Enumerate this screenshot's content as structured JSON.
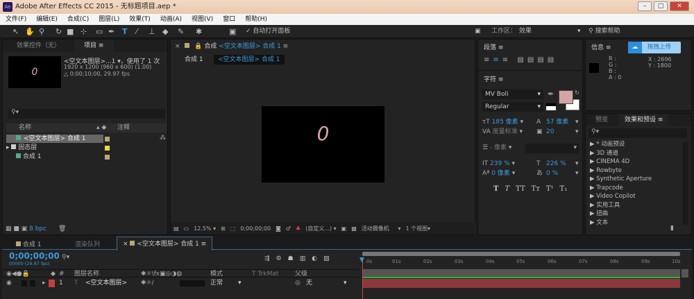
{
  "title": "Adobe After Effects CC 2015 - 无标题项目.aep *",
  "app_logo": "Ae",
  "menu": [
    "文件(F)",
    "编辑(E)",
    "合成(C)",
    "图层(L)",
    "效果(T)",
    "动画(A)",
    "视图(V)",
    "窗口",
    "帮助(H)"
  ],
  "toolbar": {
    "auto_open": "自动打开面板",
    "workspace_label": "工作区：",
    "workspace": "效果",
    "search_help": "搜索帮助"
  },
  "project": {
    "tab_effects": "效果控件（无）",
    "tab_project": "项目",
    "item_name": "<空文本图层>...1 ▾，使用了 1 次",
    "item_size": "1920 x 1200  (960 x 600) (1.00)",
    "item_duration": "△ 0;00;10;00, 29.97 fps",
    "preview_glyph": "0",
    "col_name": "名称",
    "col_comment": "注释",
    "items": [
      {
        "name": "<空文本图层> 合成 1",
        "color": "#b8a878"
      },
      {
        "name": "固态层",
        "color": "#e8d84a"
      },
      {
        "name": "合成 1",
        "color": "#b8a878"
      }
    ],
    "bpc": "8 bpc"
  },
  "composition": {
    "tab_prefix": "合成",
    "tab_name": "<空文本图层> 合成 1",
    "breadcrumb": [
      "合成 1",
      "<空文本图层> 合成 1"
    ],
    "glyph": "0",
    "zoom": "12.5%",
    "timecode": "0;00;00;00",
    "resolution": "(自定义...)",
    "camera": "活动摄像机",
    "views": "1 个视图"
  },
  "paragraph": {
    "title": "段落"
  },
  "character": {
    "title": "字符",
    "font": "MV Boli",
    "style": "Regular",
    "size": "185 像素",
    "leading": "57 像素",
    "kerning": "度量标准",
    "tracking": "20",
    "stroke": "- 像素",
    "vscale": "239 %",
    "hscale": "226 %",
    "baseline": "0 像素",
    "tsume": "0 %",
    "fill_color": "#d4a5a5",
    "styles": [
      "T",
      "T",
      "TT",
      "Tт",
      "T¹",
      "T₁"
    ]
  },
  "info": {
    "title": "信息",
    "upload": "拖拽上传",
    "r": "R :",
    "g": "G :",
    "b": "B :",
    "a": "A : 0",
    "x": "X : 2696",
    "y": "Y : 1800"
  },
  "effects": {
    "tab_preview": "预览",
    "tab_presets": "效果和预设",
    "items": [
      "▶ * 动画预设",
      "▶ 3D 通道",
      "▶ CINEMA 4D",
      "▶ Rowbyte",
      "▶ Synthetic Aperture",
      "▶ Trapcode",
      "▶ Video Copilot",
      "▶ 实用工具",
      "▶ 扭曲",
      "▶ 文本"
    ]
  },
  "timeline": {
    "tabs": [
      "合成 1",
      "渲染队列",
      "<空文本图层> 合成 1"
    ],
    "timecode": "0;00;00;00",
    "frames": "00000 (29.97 fps)",
    "col_layer": "图层名称",
    "col_mode": "模式",
    "col_trkmat": "T  TrkMat",
    "col_parent": "父级",
    "col_num": "#",
    "layer_num": "1",
    "layer_name": "<空文本图层>",
    "layer_mode": "正常",
    "layer_parent": "无",
    "ticks": [
      "0s",
      "01s",
      "02s",
      "03s",
      "04s",
      "05s",
      "06s",
      "07s",
      "08s",
      "09s",
      "10s"
    ]
  }
}
